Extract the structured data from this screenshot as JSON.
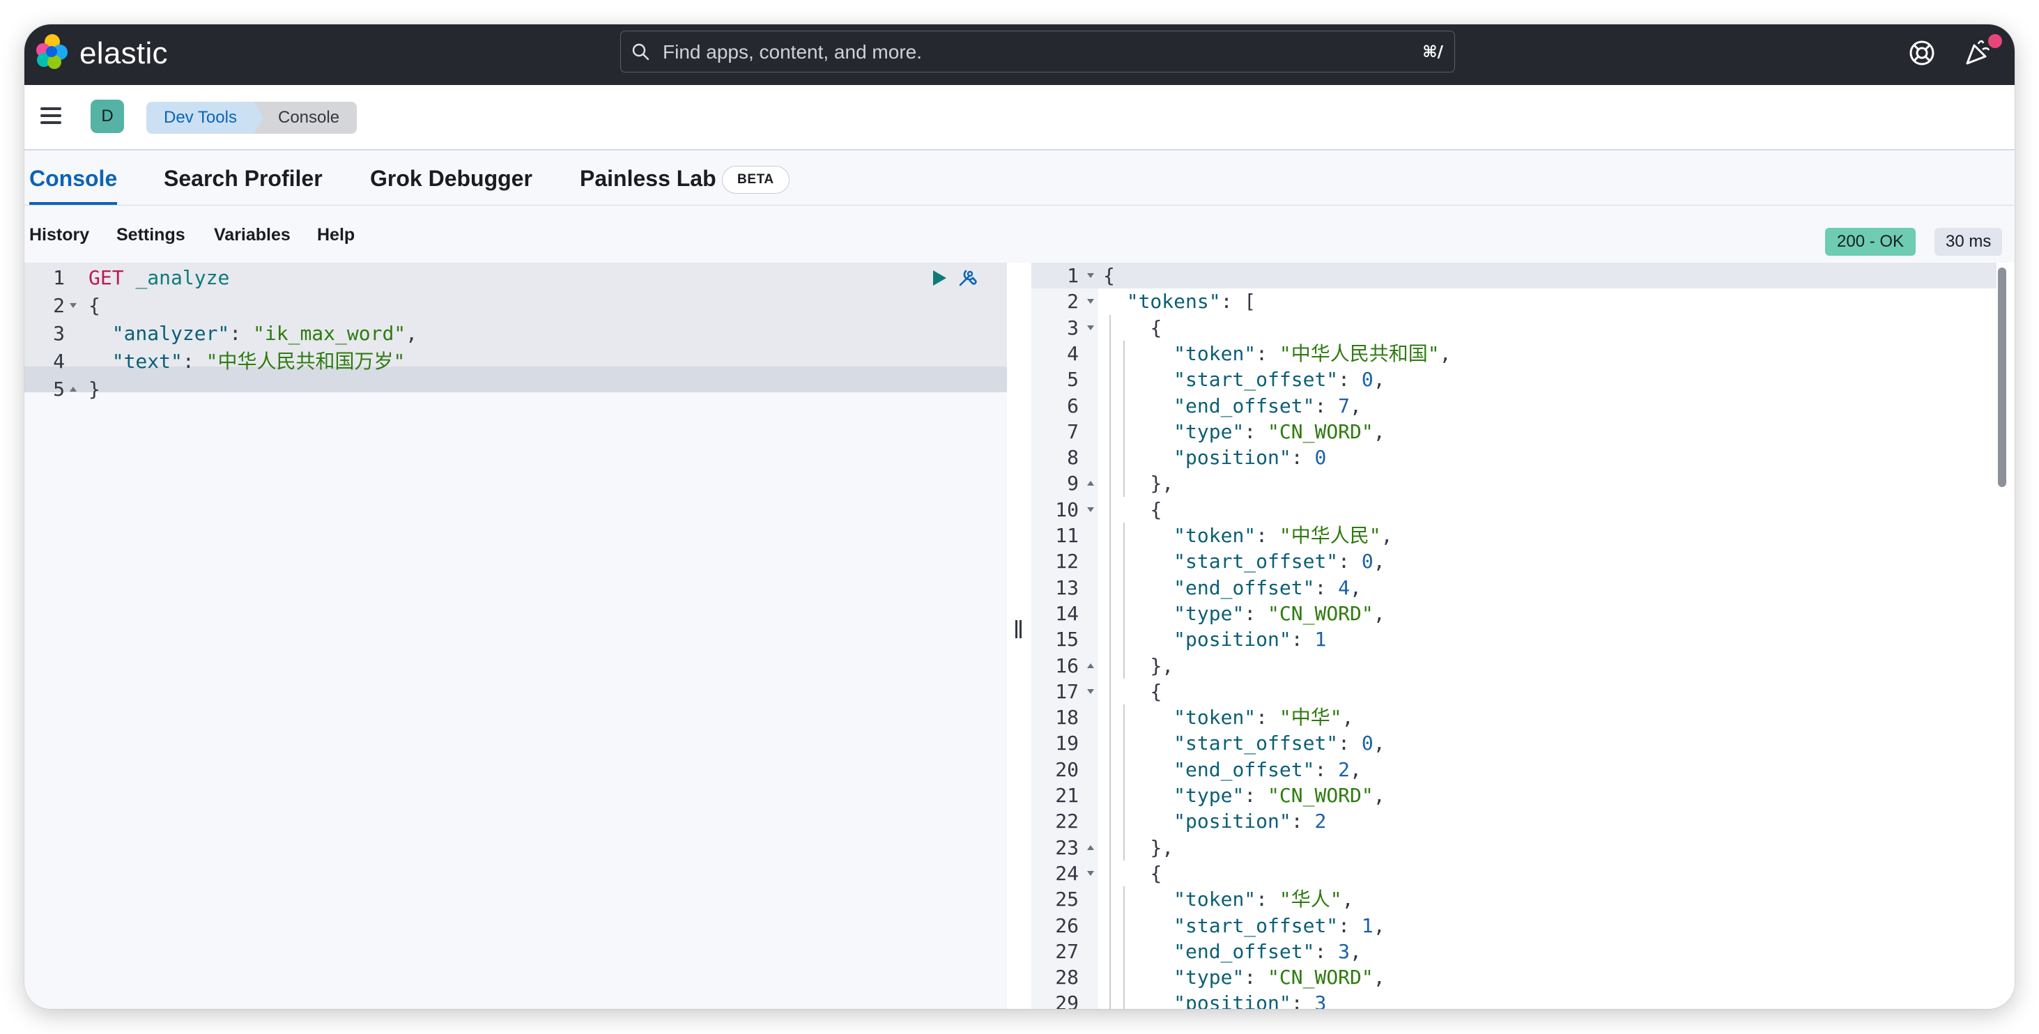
{
  "header": {
    "brand": "elastic",
    "search_placeholder": "Find apps, content, and more.",
    "search_shortcut": "⌘/",
    "icons": [
      "elastic-logo-icon",
      "search-icon",
      "help-icon",
      "newsfeed-icon"
    ],
    "colors": {
      "background": "#25282f",
      "notification_dot": "#e8457a"
    }
  },
  "breadcrumbs": {
    "space_avatar": "D",
    "items": [
      "Dev Tools",
      "Console"
    ]
  },
  "tabs": {
    "items": [
      "Console",
      "Search Profiler",
      "Grok Debugger",
      "Painless Lab"
    ],
    "active": "Console",
    "beta_badge": "BETA"
  },
  "toolbar": {
    "links": [
      "History",
      "Settings",
      "Variables",
      "Help"
    ],
    "status": "200 - OK",
    "duration": "30 ms",
    "colors": {
      "status_ok": "#6dccb1",
      "accent": "#0b64b4"
    }
  },
  "request_editor": {
    "line_numbers": [
      "1",
      "2",
      "3",
      "4",
      "5"
    ],
    "method": "GET",
    "path": "_analyze",
    "lines": [
      "GET _analyze",
      "{",
      "  \"analyzer\": \"ik_max_word\",",
      "  \"text\": \"中华人民共和国万岁\"",
      "}"
    ],
    "icons": [
      "play-icon",
      "wrench-icon"
    ]
  },
  "response_editor": {
    "line_numbers": [
      "1",
      "2",
      "3",
      "4",
      "5",
      "6",
      "7",
      "8",
      "9",
      "10",
      "11",
      "12",
      "13",
      "14",
      "15",
      "16",
      "17",
      "18",
      "19",
      "20",
      "21",
      "22",
      "23",
      "24",
      "25",
      "26",
      "27",
      "28",
      "29"
    ],
    "lines": [
      "{",
      "  \"tokens\": [",
      "    {",
      "      \"token\": \"中华人民共和国\",",
      "      \"start_offset\": 0,",
      "      \"end_offset\": 7,",
      "      \"type\": \"CN_WORD\",",
      "      \"position\": 0",
      "    },",
      "    {",
      "      \"token\": \"中华人民\",",
      "      \"start_offset\": 0,",
      "      \"end_offset\": 4,",
      "      \"type\": \"CN_WORD\",",
      "      \"position\": 1",
      "    },",
      "    {",
      "      \"token\": \"中华\",",
      "      \"start_offset\": 0,",
      "      \"end_offset\": 2,",
      "      \"type\": \"CN_WORD\",",
      "      \"position\": 2",
      "    },",
      "    {",
      "      \"token\": \"华人\",",
      "      \"start_offset\": 1,",
      "      \"end_offset\": 3,",
      "      \"type\": \"CN_WORD\",",
      "      \"position\": 3"
    ]
  }
}
